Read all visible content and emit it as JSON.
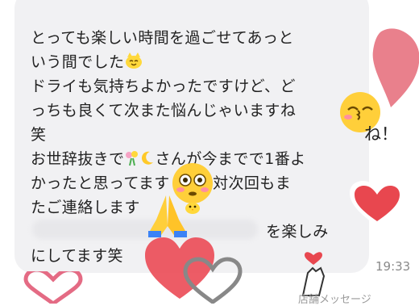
{
  "message": {
    "lines": [
      "とっても楽しい時間を過ごせてあっと",
      "いう間でした",
      "ドライも気持ちよかったですけど、ど",
      "っちも良くて次また悩んじゃいますね",
      "笑",
      "お世辞抜きで",
      "さんが今までで1番よ",
      "かったと思ってます",
      "絶対次回もま",
      "たご連絡します",
      "を楽しみ",
      "にしてます笑"
    ],
    "timestamp": "19:33"
  },
  "decorations": {
    "ne_text": "ね！",
    "footer_label": "店舗メッセージ"
  },
  "icons": [
    "smile-cat-emoji",
    "kissing-face-emoji",
    "flower-bouquet-emoji",
    "crescent-moon-emoji",
    "flushed-face-emoji",
    "praying-hands-emoji",
    "heart-sticker",
    "outline-heart-sticker",
    "finger-heart-sticker"
  ],
  "colors": {
    "bubble": "#f1f1f3",
    "heart_red": "#e8474f",
    "watercolor_pink": "#e56a78"
  }
}
